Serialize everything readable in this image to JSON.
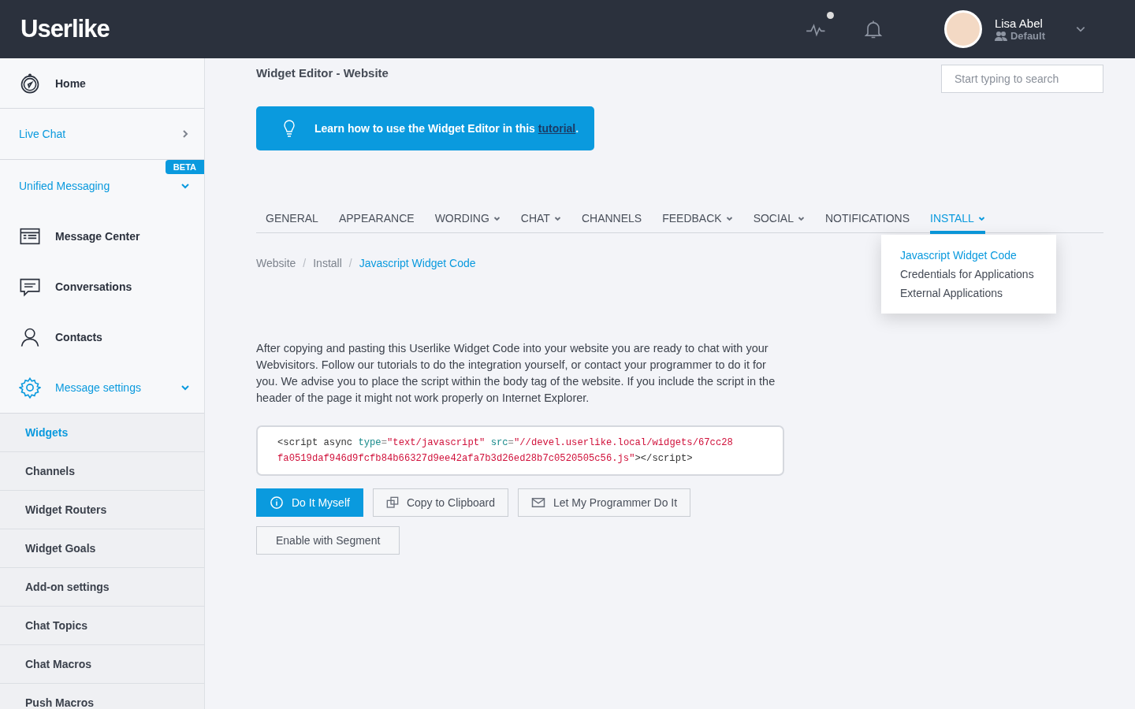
{
  "header": {
    "logo": "Userlike",
    "activity_dot": true,
    "user": {
      "name": "Lisa Abel",
      "role": "Default"
    }
  },
  "sidebar": {
    "items": [
      {
        "kind": "link",
        "label": "Home"
      },
      {
        "kind": "section",
        "label": "Live Chat",
        "expanded": false
      },
      {
        "kind": "section",
        "label": "Unified Messaging",
        "expanded": true,
        "badge": "BETA"
      },
      {
        "kind": "link",
        "label": "Message Center"
      },
      {
        "kind": "link",
        "label": "Conversations"
      },
      {
        "kind": "link",
        "label": "Contacts"
      },
      {
        "kind": "section",
        "label": "Message settings",
        "expanded": true
      },
      {
        "kind": "sub",
        "label": "Widgets",
        "selected": true
      },
      {
        "kind": "sub",
        "label": "Channels",
        "selected": false
      },
      {
        "kind": "sub",
        "label": "Widget Routers",
        "selected": false
      },
      {
        "kind": "sub",
        "label": "Widget Goals",
        "selected": false
      },
      {
        "kind": "sub",
        "label": "Add-on settings",
        "selected": false
      },
      {
        "kind": "sub",
        "label": "Chat Topics",
        "selected": false
      },
      {
        "kind": "sub",
        "label": "Chat Macros",
        "selected": false
      },
      {
        "kind": "sub",
        "label": "Push Macros",
        "selected": false
      }
    ]
  },
  "page": {
    "title": "Widget Editor - Website",
    "search": {
      "placeholder": "Start typing to search"
    },
    "banner": {
      "text": "Learn how to use the Widget Editor in this ",
      "link": "tutorial",
      "end": "."
    },
    "tabs": [
      {
        "label": "GENERAL",
        "menu": false,
        "selected": false
      },
      {
        "label": "APPEARANCE",
        "menu": false,
        "selected": false
      },
      {
        "label": "WORDING",
        "menu": true,
        "selected": false
      },
      {
        "label": "CHAT",
        "menu": true,
        "selected": false
      },
      {
        "label": "CHANNELS",
        "menu": false,
        "selected": false
      },
      {
        "label": "FEEDBACK",
        "menu": true,
        "selected": false
      },
      {
        "label": "SOCIAL",
        "menu": true,
        "selected": false
      },
      {
        "label": "NOTIFICATIONS",
        "menu": false,
        "selected": false
      },
      {
        "label": "INSTALL",
        "menu": true,
        "selected": true
      }
    ],
    "tab_menu": [
      {
        "label": "Javascript Widget Code",
        "selected": true
      },
      {
        "label": "Credentials for Applications",
        "selected": false
      },
      {
        "label": "External Applications",
        "selected": false
      }
    ],
    "breadcrumbs": [
      {
        "label": "Website",
        "current": false
      },
      {
        "label": "Install",
        "current": false
      },
      {
        "label": "Javascript Widget Code",
        "current": true
      }
    ],
    "breadcrumb_separator": "/",
    "description": "After copying and pasting this Userlike Widget Code into your website you are ready to chat with your Webvisitors. Follow our tutorials to do the integration yourself, or contact your programmer to do it for you. We advise you to place the script within the body tag of the website. If you include the script in the header of the page it might not work properly on Internet Explorer.",
    "code_lines": [
      [
        {
          "kind": "plain",
          "text": "<script async "
        },
        {
          "kind": "attr",
          "text": "type"
        },
        {
          "kind": "eq",
          "text": "="
        },
        {
          "kind": "string",
          "text": "\"text/javascript\""
        },
        {
          "kind": "attr",
          "text": " src"
        },
        {
          "kind": "eq",
          "text": "="
        },
        {
          "kind": "string",
          "text": "\"//devel.userlike.local/widgets/67cc28"
        }
      ],
      [
        {
          "kind": "string",
          "text": "fa0519daf946d9fcfb84b66327d9ee42afa7b3d26ed28b7c0520505c56.js\""
        },
        {
          "kind": "plain",
          "text": "></script>"
        }
      ]
    ],
    "buttons": [
      {
        "label": "Do It Myself",
        "primary": true
      },
      {
        "label": "Copy to Clipboard",
        "primary": false
      },
      {
        "label": "Let My Programmer Do It",
        "primary": false
      },
      {
        "label": "Enable with Segment",
        "primary": false
      }
    ]
  }
}
